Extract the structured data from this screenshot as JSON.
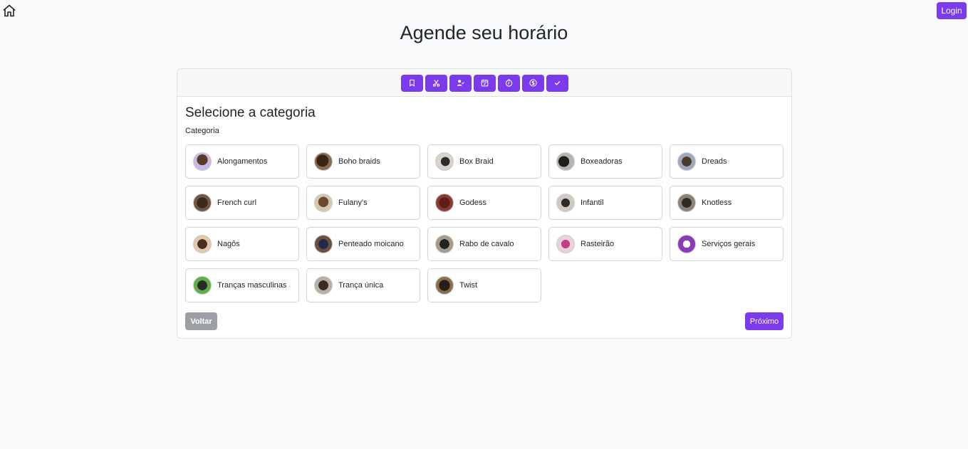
{
  "header": {
    "title": "Agende seu horário",
    "login_label": "Login",
    "home_icon": "home-icon"
  },
  "steps": [
    {
      "icon": "bookmark-icon"
    },
    {
      "icon": "scissors-icon"
    },
    {
      "icon": "user-check-icon"
    },
    {
      "icon": "calendar-icon"
    },
    {
      "icon": "clock-icon"
    },
    {
      "icon": "dollar-icon"
    },
    {
      "icon": "check-icon"
    }
  ],
  "main": {
    "section_title": "Selecione a categoria",
    "field_label": "Categoria",
    "categories": [
      {
        "label": "Alongamentos"
      },
      {
        "label": "Boho braids"
      },
      {
        "label": "Box Braid"
      },
      {
        "label": "Boxeadoras"
      },
      {
        "label": "Dreads"
      },
      {
        "label": "French curl"
      },
      {
        "label": "Fulany's"
      },
      {
        "label": "Godess"
      },
      {
        "label": "Infantil"
      },
      {
        "label": "Knotless"
      },
      {
        "label": "Nagôs"
      },
      {
        "label": "Penteado moicano"
      },
      {
        "label": "Rabo de cavalo"
      },
      {
        "label": "Rasteirão"
      },
      {
        "label": "Serviços gerais"
      },
      {
        "label": "Tranças masculinas"
      },
      {
        "label": "Trança única"
      },
      {
        "label": "Twist"
      }
    ],
    "back_label": "Voltar",
    "next_label": "Próximo"
  },
  "colors": {
    "primary": "#7c3aed",
    "secondary": "#9ca0a5",
    "background": "#f8f9fa"
  }
}
